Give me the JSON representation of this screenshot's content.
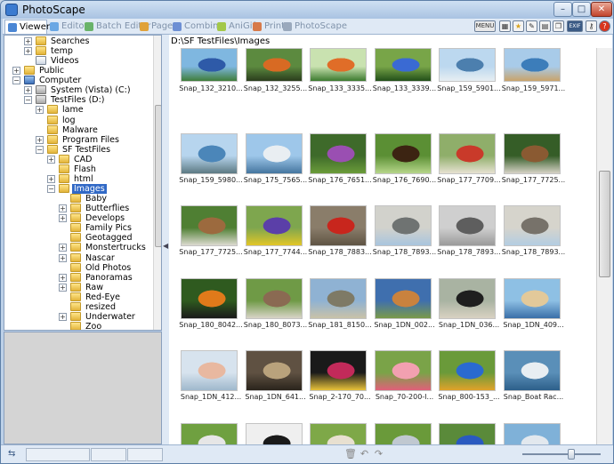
{
  "window": {
    "title": "PhotoScape",
    "minimize_glyph": "–",
    "maximize_glyph": "□",
    "close_glyph": "✕"
  },
  "tabs": [
    {
      "label": "Viewer",
      "active": true,
      "color": "#4a86d4"
    },
    {
      "label": "Editor",
      "active": false,
      "color": "#6aa7e4"
    },
    {
      "label": "Batch Editor",
      "active": false,
      "color": "#69b36a"
    },
    {
      "label": "Page",
      "active": false,
      "color": "#e0a23a"
    },
    {
      "label": "Combine",
      "active": false,
      "color": "#6d8fd4"
    },
    {
      "label": "AniGif",
      "active": false,
      "color": "#a3c84a"
    },
    {
      "label": "Print",
      "active": false,
      "color": "#d77a4a"
    },
    {
      "label": "PhotoScape",
      "active": false,
      "color": "#9aa9bd"
    }
  ],
  "toolbar_icons": [
    {
      "name": "menu-icon",
      "glyph": "MENU"
    },
    {
      "name": "calendar-icon",
      "glyph": "▦"
    },
    {
      "name": "star-icon",
      "glyph": "★"
    },
    {
      "name": "tools-icon",
      "glyph": "✎"
    },
    {
      "name": "open-folder-icon",
      "glyph": "▤"
    },
    {
      "name": "copy-icon",
      "glyph": "❐"
    },
    {
      "name": "exif-icon",
      "glyph": "EXIF"
    },
    {
      "name": "key-icon",
      "glyph": "⚷"
    },
    {
      "name": "help-icon",
      "glyph": "?"
    }
  ],
  "tree": [
    {
      "label": "Searches",
      "level": 0,
      "expander": "+",
      "icon": "folder"
    },
    {
      "label": "temp",
      "level": 0,
      "expander": "+",
      "icon": "folder"
    },
    {
      "label": "Videos",
      "level": 0,
      "expander": "",
      "icon": "doc"
    },
    {
      "label": "Public",
      "level": -1,
      "expander": "+",
      "icon": "folder"
    },
    {
      "label": "Computer",
      "level": -1,
      "expander": "−",
      "icon": "comp"
    },
    {
      "label": "System (Vista) (C:)",
      "level": 0,
      "expander": "+",
      "icon": "drive"
    },
    {
      "label": "TestFiles (D:)",
      "level": 0,
      "expander": "−",
      "icon": "drive"
    },
    {
      "label": "lame",
      "level": 1,
      "expander": "+",
      "icon": "folder"
    },
    {
      "label": "log",
      "level": 1,
      "expander": "",
      "icon": "folder"
    },
    {
      "label": "Malware",
      "level": 1,
      "expander": "",
      "icon": "folder"
    },
    {
      "label": "Program Files",
      "level": 1,
      "expander": "+",
      "icon": "folder"
    },
    {
      "label": "SF TestFiles",
      "level": 1,
      "expander": "−",
      "icon": "folder"
    },
    {
      "label": "CAD",
      "level": 2,
      "expander": "+",
      "icon": "folder"
    },
    {
      "label": "Flash",
      "level": 2,
      "expander": "",
      "icon": "folder"
    },
    {
      "label": "html",
      "level": 2,
      "expander": "+",
      "icon": "folder"
    },
    {
      "label": "Images",
      "level": 2,
      "expander": "−",
      "icon": "folder",
      "selected": true
    },
    {
      "label": "Baby",
      "level": 3,
      "expander": "",
      "icon": "folder"
    },
    {
      "label": "Butterflies",
      "level": 3,
      "expander": "+",
      "icon": "folder"
    },
    {
      "label": "Develops",
      "level": 3,
      "expander": "+",
      "icon": "folder"
    },
    {
      "label": "Family Pics",
      "level": 3,
      "expander": "",
      "icon": "folder"
    },
    {
      "label": "Geotagged",
      "level": 3,
      "expander": "",
      "icon": "folder"
    },
    {
      "label": "Monstertrucks",
      "level": 3,
      "expander": "+",
      "icon": "folder"
    },
    {
      "label": "Nascar",
      "level": 3,
      "expander": "+",
      "icon": "folder"
    },
    {
      "label": "Old Photos",
      "level": 3,
      "expander": "",
      "icon": "folder"
    },
    {
      "label": "Panoramas",
      "level": 3,
      "expander": "+",
      "icon": "folder"
    },
    {
      "label": "Raw",
      "level": 3,
      "expander": "+",
      "icon": "folder"
    },
    {
      "label": "Red-Eye",
      "level": 3,
      "expander": "",
      "icon": "folder"
    },
    {
      "label": "resized",
      "level": 3,
      "expander": "",
      "icon": "folder"
    },
    {
      "label": "Underwater",
      "level": 3,
      "expander": "+",
      "icon": "folder"
    },
    {
      "label": "Zoo",
      "level": 3,
      "expander": "",
      "icon": "folder"
    }
  ],
  "path": "D:\\SF TestFiles\\Images",
  "thumbnails": [
    {
      "caption": "Snap_132_3210...",
      "colors": [
        "#7fb7e0",
        "#2e5aa8",
        "#3f7d3a"
      ]
    },
    {
      "caption": "Snap_132_3255...",
      "colors": [
        "#5c8a3f",
        "#d86a23",
        "#2a3d1d"
      ]
    },
    {
      "caption": "Snap_133_3335...",
      "colors": [
        "#c9e2b0",
        "#e06d28",
        "#3c7a2f"
      ]
    },
    {
      "caption": "Snap_133_3339...",
      "colors": [
        "#78a548",
        "#3a6ad3",
        "#224f19"
      ]
    },
    {
      "caption": "Snap_159_5901...",
      "colors": [
        "#bcd8ef",
        "#4c7fae",
        "#e7eef2"
      ]
    },
    {
      "caption": "Snap_159_5971...",
      "colors": [
        "#a8cbe9",
        "#3c7dba",
        "#c9a36a"
      ]
    },
    {
      "caption": "Snap_159_5980...",
      "colors": [
        "#b7d5ee",
        "#4b86b9",
        "#5d7a83"
      ]
    },
    {
      "caption": "Snap_175_7565...",
      "colors": [
        "#9ec7ea",
        "#e9eef2",
        "#45769f"
      ]
    },
    {
      "caption": "Snap_176_7651...",
      "colors": [
        "#3e6a2a",
        "#9a4fb2",
        "#6b9c3a"
      ]
    },
    {
      "caption": "Snap_176_7690...",
      "colors": [
        "#5b8f34",
        "#3c2412",
        "#b6d68a"
      ]
    },
    {
      "caption": "Snap_177_7709...",
      "colors": [
        "#8fae6a",
        "#c93a2a",
        "#e7e2d2"
      ]
    },
    {
      "caption": "Snap_177_7725...",
      "colors": [
        "#355d27",
        "#8a5a32",
        "#d6d2c6"
      ]
    },
    {
      "caption": "Snap_177_7725...",
      "colors": [
        "#4f7f33",
        "#9c6a3e",
        "#dcdad0"
      ]
    },
    {
      "caption": "Snap_177_7744...",
      "colors": [
        "#7ea64e",
        "#5b3fa8",
        "#e2c628"
      ]
    },
    {
      "caption": "Snap_178_7883...",
      "colors": [
        "#8a7d6a",
        "#c8261d",
        "#5f5444"
      ]
    },
    {
      "caption": "Snap_178_7893...",
      "colors": [
        "#d2d2cc",
        "#6f7372",
        "#a9c5de"
      ]
    },
    {
      "caption": "Snap_178_7893...",
      "colors": [
        "#cfcfcf",
        "#5e5e5e",
        "#9a9a9a"
      ]
    },
    {
      "caption": "Snap_178_7893...",
      "colors": [
        "#d6d4cc",
        "#77726a",
        "#b3cde2"
      ]
    },
    {
      "caption": "Snap_180_8042...",
      "colors": [
        "#2f5a1f",
        "#e07a1a",
        "#1a1a1a"
      ]
    },
    {
      "caption": "Snap_180_8073...",
      "colors": [
        "#6f9a46",
        "#8a6a52",
        "#d8d4c8"
      ]
    },
    {
      "caption": "Snap_181_8150...",
      "colors": [
        "#8fb2d3",
        "#7e7a66",
        "#c9c2a8"
      ]
    },
    {
      "caption": "Snap_1DN_002...",
      "colors": [
        "#3f6fae",
        "#c9823e",
        "#7a9a4a"
      ]
    },
    {
      "caption": "Snap_1DN_036...",
      "colors": [
        "#a9b3a2",
        "#1f1f1f",
        "#d9d2c2"
      ]
    },
    {
      "caption": "Snap_1DN_409...",
      "colors": [
        "#8ec0e4",
        "#e2c99a",
        "#3a6fa8"
      ]
    },
    {
      "caption": "Snap_1DN_412...",
      "colors": [
        "#d7e3ee",
        "#e8b8a0",
        "#9fb8cc"
      ]
    },
    {
      "caption": "Snap_1DN_641...",
      "colors": [
        "#5f5142",
        "#b9a27c",
        "#2a241c"
      ]
    },
    {
      "caption": "Snap_2-170_70...",
      "colors": [
        "#1a1a1a",
        "#c22a5a",
        "#e8c23a"
      ]
    },
    {
      "caption": "Snap_70-200-I...",
      "colors": [
        "#7aa348",
        "#f2a0b0",
        "#e0607a"
      ]
    },
    {
      "caption": "Snap_800-153_...",
      "colors": [
        "#6a9a3a",
        "#2a6ad0",
        "#e0a22a"
      ]
    },
    {
      "caption": "Snap_Boat Rac...",
      "colors": [
        "#5a8fb8",
        "#e8eef2",
        "#2d5f8a"
      ]
    },
    {
      "caption": "",
      "colors": [
        "#6fa040",
        "#e6e6e6",
        "#3460b8"
      ]
    },
    {
      "caption": "",
      "colors": [
        "#efefef",
        "#1a1a1a",
        "#c82a2a"
      ]
    },
    {
      "caption": "",
      "colors": [
        "#7ea848",
        "#e8e0d0",
        "#1a1a1a"
      ]
    },
    {
      "caption": "",
      "colors": [
        "#6a9a3a",
        "#c0c8d0",
        "#3a6ad0"
      ]
    },
    {
      "caption": "",
      "colors": [
        "#5a8a3a",
        "#2a5ac0",
        "#e8e8e8"
      ]
    },
    {
      "caption": "",
      "colors": [
        "#7fb1d8",
        "#e2e8ee",
        "#3a6fa0"
      ]
    }
  ],
  "zoom_level": 0.64
}
